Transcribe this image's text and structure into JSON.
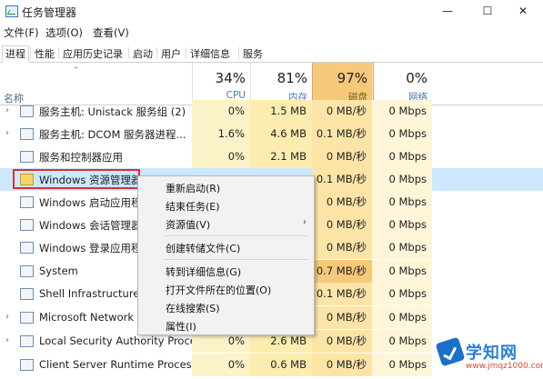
{
  "window": {
    "title": "任务管理器",
    "minimize_label": "—",
    "maximize_label": "☐",
    "close_label": "✕"
  },
  "menubar": [
    "文件(F)",
    "选项(O)",
    "查看(V)"
  ],
  "tabs": [
    "进程",
    "性能",
    "应用历史记录",
    "启动",
    "用户",
    "详细信息",
    "服务"
  ],
  "columns": {
    "name_label": "名称",
    "cpu": {
      "percent": "34%",
      "label": "CPU"
    },
    "memory": {
      "percent": "81%",
      "label": "内存"
    },
    "disk": {
      "percent": "97%",
      "label": "磁盘"
    },
    "network": {
      "percent": "0%",
      "label": "网络"
    }
  },
  "rows": [
    {
      "name": "服务主机: Unistack 服务组 (2)",
      "cpu": "0%",
      "memory": "1.5 MB",
      "disk": "0 MB/秒",
      "network": "0 Mbps",
      "expandable": true
    },
    {
      "name": "服务主机: DCOM 服务器进程...",
      "cpu": "1.6%",
      "memory": "4.6 MB",
      "disk": "0.1 MB/秒",
      "network": "0 Mbps",
      "expandable": true
    },
    {
      "name": "服务和控制器应用",
      "cpu": "0%",
      "memory": "2.1 MB",
      "disk": "0 MB/秒",
      "network": "0 Mbps",
      "expandable": false
    },
    {
      "name": "Windows 资源管理器",
      "cpu": "",
      "memory": "",
      "disk": "0.1 MB/秒",
      "network": "0 Mbps",
      "expandable": false
    },
    {
      "name": "Windows 启动应用程序",
      "cpu": "",
      "memory": "",
      "disk": "0 MB/秒",
      "network": "0 Mbps",
      "expandable": false
    },
    {
      "name": "Windows 会话管理器",
      "cpu": "",
      "memory": "",
      "disk": "0 MB/秒",
      "network": "0 Mbps",
      "expandable": false
    },
    {
      "name": "Windows 登录应用程",
      "cpu": "",
      "memory": "",
      "disk": "0 MB/秒",
      "network": "0 Mbps",
      "expandable": false
    },
    {
      "name": "System",
      "cpu": "",
      "memory": "",
      "disk": "0.7 MB/秒",
      "network": "0 Mbps",
      "expandable": false
    },
    {
      "name": "Shell Infrastructure H",
      "cpu": "",
      "memory": "",
      "disk": "0.1 MB/秒",
      "network": "0 Mbps",
      "expandable": false
    },
    {
      "name": "Microsoft Network R",
      "cpu": "",
      "memory": "",
      "disk": "0 MB/秒",
      "network": "0 Mbps",
      "expandable": true
    },
    {
      "name": "Local Security Authority Proce...",
      "cpu": "0%",
      "memory": "2.6 MB",
      "disk": "0 MB/秒",
      "network": "0 Mbps",
      "expandable": true
    },
    {
      "name": "Client Server Runtime Process",
      "cpu": "0%",
      "memory": "0.6 MB",
      "disk": "0 MB/秒",
      "network": "0 Mbps",
      "expandable": false
    }
  ],
  "context_menu": {
    "items": [
      "重新启动(R)",
      "结束任务(E)",
      "资源值(V)",
      "创建转储文件(C)",
      "转到详细信息(G)",
      "打开文件所在的位置(O)",
      "在线搜索(S)",
      "属性(I)"
    ],
    "submenu_arrow": "›"
  },
  "watermark": {
    "title": "学知网",
    "url": "www.jmqz1000.com"
  },
  "colors": {
    "accent_blue": "#4a7ab0",
    "highlight_red": "#d93030",
    "disk_header_bg": "#f6c97a"
  }
}
